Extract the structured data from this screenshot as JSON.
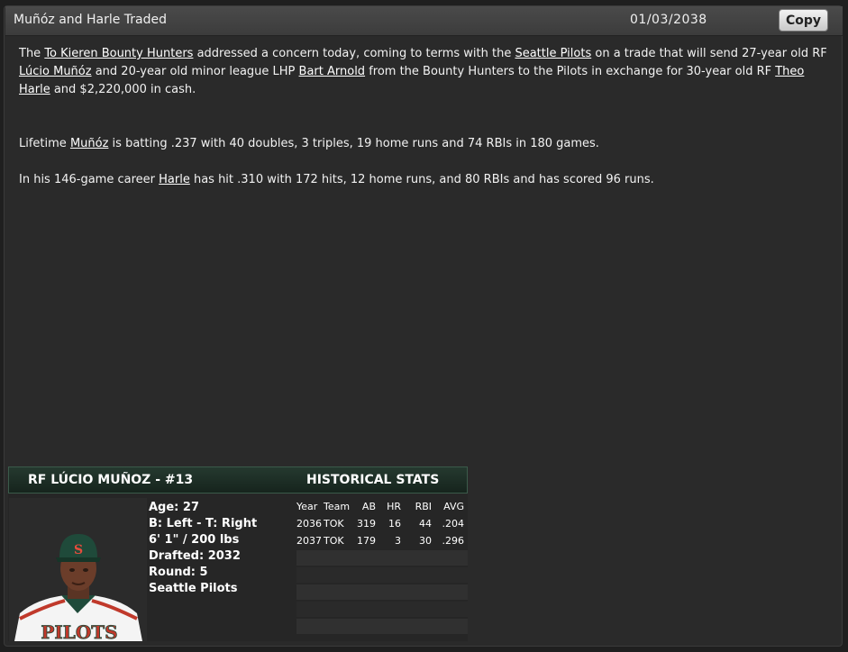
{
  "header": {
    "title": "Muñóz and Harle Traded",
    "date": "01/03/2038",
    "copy_label": "Copy"
  },
  "article": {
    "p1": {
      "t1": "The ",
      "l1": "To Kieren Bounty Hunters",
      "t2": " addressed a concern today, coming to terms with the ",
      "l2": "Seattle Pilots",
      "t3": " on a trade that will send 27-year old RF ",
      "l3": "Lúcio Muñóz",
      "t4": " and 20-year old minor league LHP ",
      "l4": "Bart Arnold",
      "t5": " from the Bounty Hunters to the Pilots in exchange for 30-year old RF ",
      "l5": "Theo Harle",
      "t6": " and $2,220,000 in cash."
    },
    "p2": {
      "t1": "Lifetime ",
      "l1": "Muñóz",
      "t2": " is batting .237 with 40 doubles, 3 triples, 19 home runs and 74 RBIs in 180 games."
    },
    "p3": {
      "t1": "In his 146-game career ",
      "l1": "Harle",
      "t2": " has hit .310 with 172 hits, 12 home runs, and 80 RBIs and has scored 96 runs."
    }
  },
  "player_card": {
    "name": "RF LÚCIO MUÑOZ - #13",
    "historical_title": "HISTORICAL STATS",
    "age": "Age: 27",
    "bats_throws": "B: Left - T: Right",
    "height_weight": "6' 1\" / 200 lbs",
    "drafted": "Drafted: 2032",
    "round": "Round: 5",
    "team": "Seattle Pilots",
    "jersey_text": "PILOTS",
    "cap_letter": "S",
    "stats_headers": [
      "Year",
      "Team",
      "AB",
      "HR",
      "RBI",
      "AVG"
    ],
    "stats_rows": [
      [
        "2036",
        "TOK",
        "319",
        "16",
        "44",
        ".204"
      ],
      [
        "2037",
        "TOK",
        "179",
        "3",
        "30",
        ".296"
      ]
    ]
  },
  "colors": {
    "card_header": "#1d2e25",
    "background": "#2a2a2a",
    "cap": "#1f4a3a",
    "jersey_trim": "#c0392b"
  }
}
